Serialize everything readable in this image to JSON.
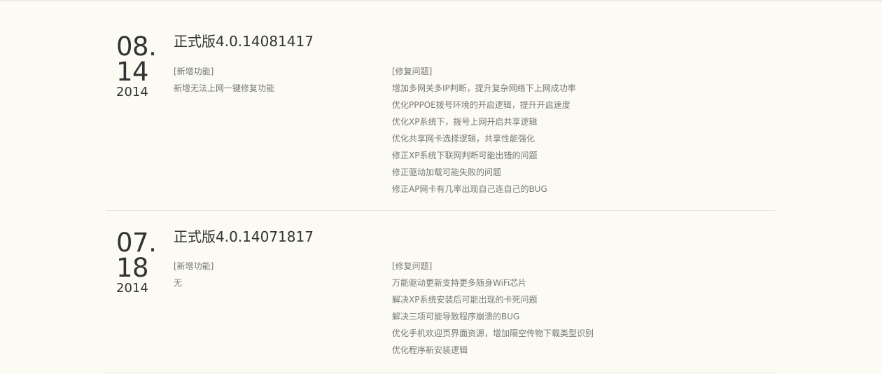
{
  "entries": [
    {
      "date_md_1": "08.",
      "date_md_2": "14",
      "year": "2014",
      "title": "正式版4.0.14081417",
      "new_heading": "[新增功能]",
      "new_items": [
        "新增无法上网一键修复功能"
      ],
      "fix_heading": "[修复问题]",
      "fix_items": [
        "增加多网关多IP判断，提升复杂网络下上网成功率",
        "优化PPPOE拨号环境的开启逻辑，提升开启速度",
        "优化XP系统下，拨号上网开启共享逻辑",
        "优化共享网卡选择逻辑，共享性能强化",
        "修正XP系统下联网判断可能出错的问题",
        "修正驱动加载可能失败的问题",
        "修正AP网卡有几率出现自己连自己的BUG"
      ]
    },
    {
      "date_md_1": "07.",
      "date_md_2": "18",
      "year": "2014",
      "title": "正式版4.0.14071817",
      "new_heading": "[新增功能]",
      "new_items": [
        "无"
      ],
      "fix_heading": "[修复问题]",
      "fix_items": [
        "万能驱动更新支持更多随身WiFi芯片",
        "解决XP系统安装后可能出现的卡死问题",
        "解决三项可能导致程序崩溃的BUG",
        "优化手机欢迎页界面资源，增加隔空传物下载类型识别",
        "优化程序新安装逻辑"
      ]
    }
  ]
}
